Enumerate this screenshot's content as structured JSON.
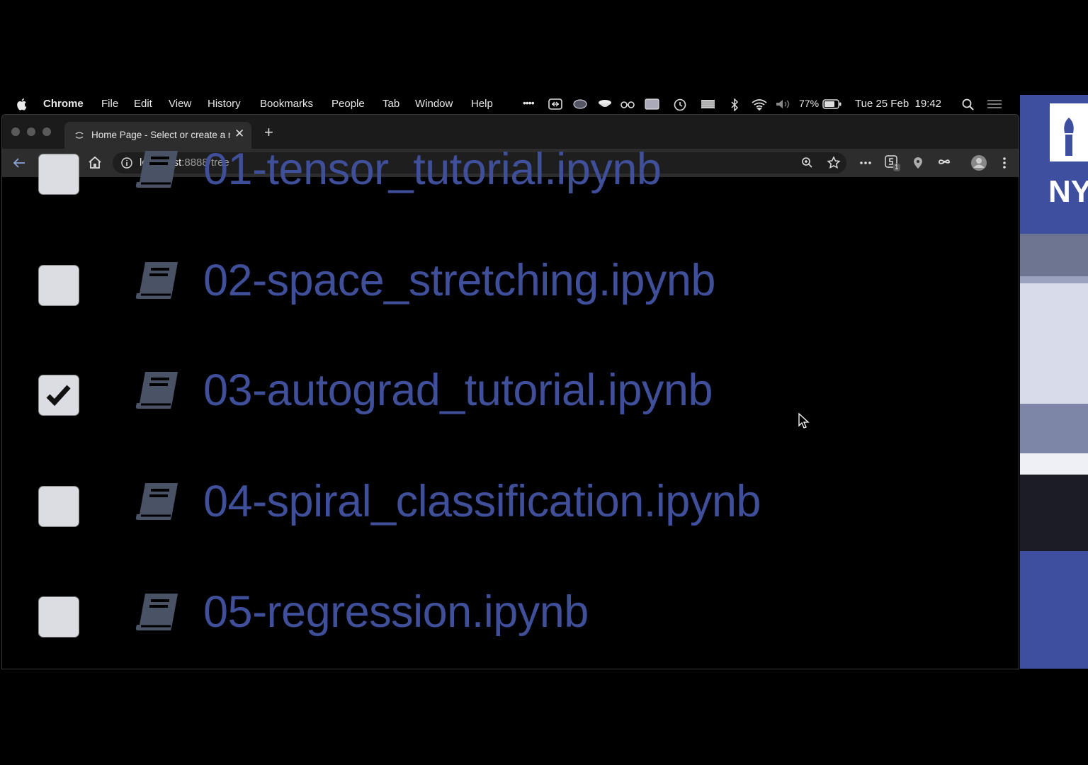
{
  "menubar": {
    "app": "Chrome",
    "items": [
      "File",
      "Edit",
      "View",
      "History",
      "Bookmarks",
      "People",
      "Tab",
      "Window",
      "Help"
    ],
    "battery": "77%",
    "datetime": "Tue 25 Feb  19:42"
  },
  "browser": {
    "tab_title": "Home Page - Select or create a n",
    "url_host": "localhost",
    "url_rest": ":8888/tree",
    "extension_badge": "1"
  },
  "files": [
    {
      "name": "01-tensor_tutorial.ipynb",
      "checked": false
    },
    {
      "name": "02-space_stretching.ipynb",
      "checked": false
    },
    {
      "name": "03-autograd_tutorial.ipynb",
      "checked": true
    },
    {
      "name": "04-spiral_classification.ipynb",
      "checked": false
    },
    {
      "name": "05-regression.ipynb",
      "checked": false
    }
  ],
  "side_panel": {
    "logo_text": "NY"
  },
  "colors": {
    "filename": "#3f4f9a",
    "side_panel": "#3f4fa0"
  }
}
